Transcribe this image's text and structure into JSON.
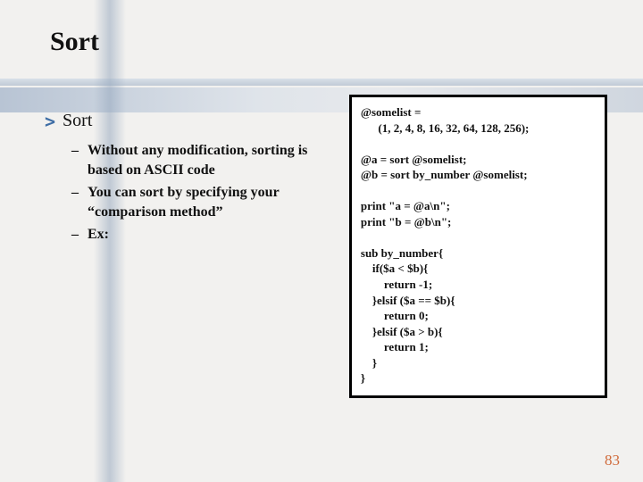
{
  "title": "Sort",
  "root_marker": ">",
  "root_label": "Sort",
  "bullets": [
    "Without any modification, sorting is based on ASCII code",
    "You can sort by specifying your “comparison method”",
    "Ex:"
  ],
  "code": "@somelist =\n      (1, 2, 4, 8, 16, 32, 64, 128, 256);\n\n@a = sort @somelist;\n@b = sort by_number @somelist;\n\nprint \"a = @a\\n\";\nprint \"b = @b\\n\";\n\nsub by_number{\n    if($a < $b){\n        return -1;\n    }elsif ($a == $b){\n        return 0;\n    }elsif ($a > b){\n        return 1;\n    }\n}",
  "page_number": "83"
}
